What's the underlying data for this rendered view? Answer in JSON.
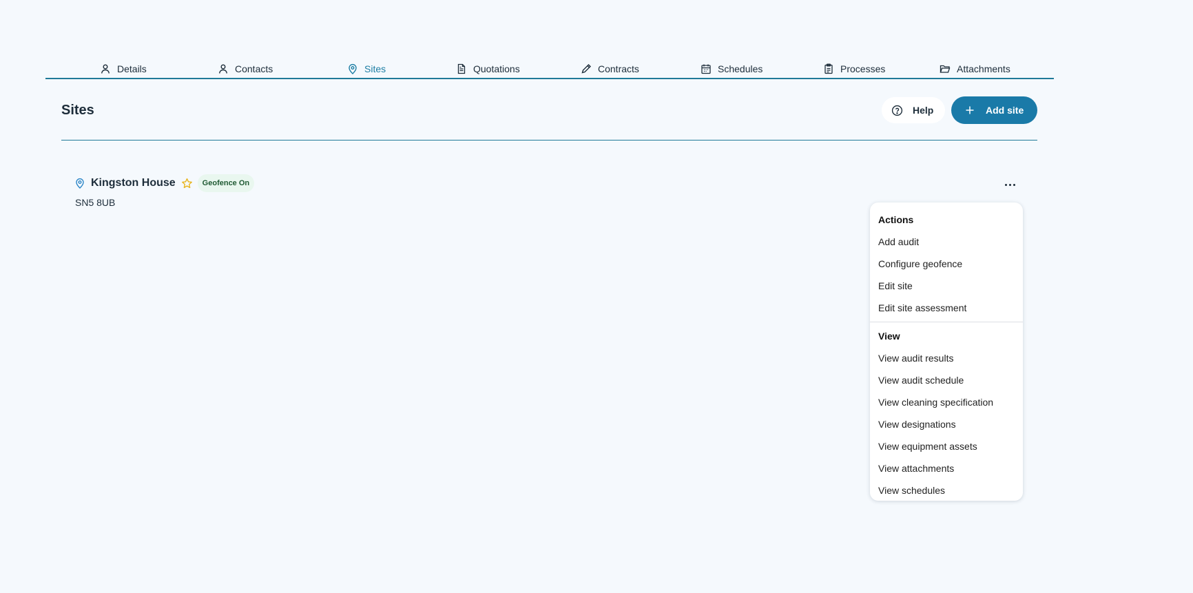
{
  "tabs": [
    {
      "label": "Details",
      "icon": "user-icon"
    },
    {
      "label": "Contacts",
      "icon": "user-icon"
    },
    {
      "label": "Sites",
      "icon": "map-pin-icon",
      "active": true
    },
    {
      "label": "Quotations",
      "icon": "document-icon"
    },
    {
      "label": "Contracts",
      "icon": "pencil-icon"
    },
    {
      "label": "Schedules",
      "icon": "calendar-icon"
    },
    {
      "label": "Processes",
      "icon": "clipboard-icon"
    },
    {
      "label": "Attachments",
      "icon": "folder-icon"
    }
  ],
  "header": {
    "title": "Sites",
    "help_label": "Help",
    "add_label": "Add site"
  },
  "site": {
    "name": "Kingston House",
    "badge": "Geofence On",
    "postcode": "SN5 8UB"
  },
  "menu": {
    "actions_header": "Actions",
    "actions": [
      "Add audit",
      "Configure geofence",
      "Edit site",
      "Edit site assessment"
    ],
    "view_header": "View",
    "views": [
      "View audit results",
      "View audit schedule",
      "View cleaning specification",
      "View designations",
      "View equipment assets",
      "View attachments",
      "View schedules"
    ]
  },
  "colors": {
    "accent": "#1a7aa8",
    "background": "#f5f9fd",
    "badge_bg": "#e9f7ef",
    "star": "#e8b41c"
  }
}
